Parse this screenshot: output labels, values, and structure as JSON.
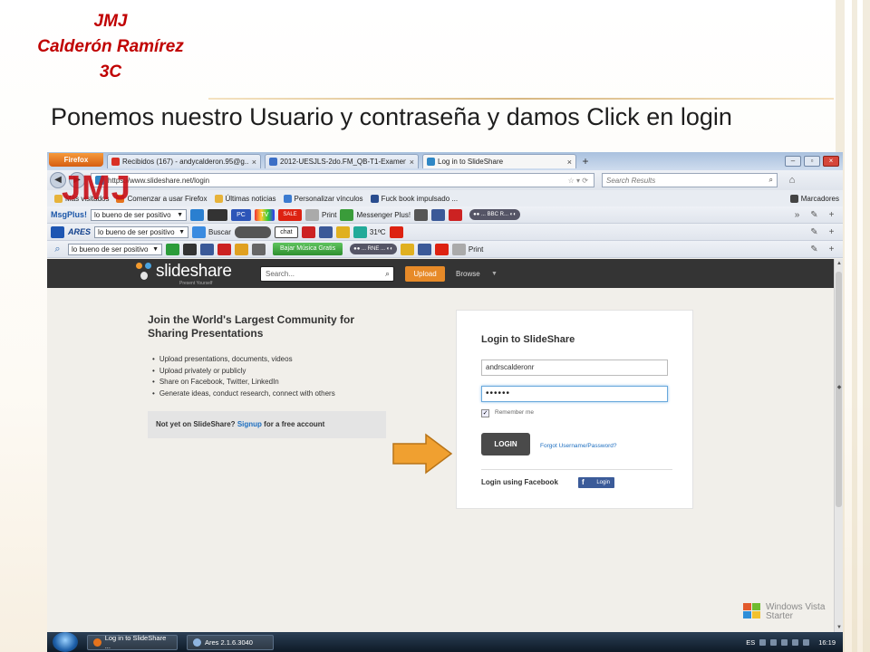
{
  "slide": {
    "author_line1": "JMJ",
    "author_line2": "Calderón Ramírez",
    "author_line3": "3C",
    "caption": "Ponemos nuestro Usuario y contraseña y damos Click en login",
    "overlay_text": "JMJ"
  },
  "browser": {
    "app_button": "Firefox",
    "tabs": [
      {
        "label": "Recibidos (167) - andycalderon.95@g...",
        "icon": "gmail-icon",
        "active": false
      },
      {
        "label": "2012-UESJLS-2do.FM_QB-T1-Examen...",
        "icon": "doc-icon",
        "active": false
      },
      {
        "label": "Log in to SlideShare",
        "icon": "slideshare-icon",
        "active": true
      }
    ],
    "url": "https://www.slideshare.net/login",
    "search_placeholder": "Search Results",
    "bookmarks": [
      "Más visitados",
      "Comenzar a usar Firefox",
      "Últimas noticias",
      "Personalizar vínculos",
      "Fuck book impulsado ..."
    ],
    "bookmarks_menu": "Marcadores",
    "toolbar1": {
      "brand": "MsgPlus!",
      "dropdown": "lo bueno de ser positivo",
      "tv": "TV",
      "sale": "SALE",
      "print": "Print",
      "messenger": "Messenger Plus!"
    },
    "toolbar2": {
      "brand": "ARES",
      "dropdown": "lo bueno de ser positivo",
      "search": "Buscar",
      "chat": "chat",
      "weather": "31ºC",
      "radio": "... BBC R..."
    },
    "toolbar3": {
      "dropdown": "lo bueno de ser positivo",
      "download": "Bajar Música Gratis",
      "print": "Print",
      "radio": "... RNE ..."
    }
  },
  "slideshare": {
    "logo": "slideshare",
    "logo_sub": "Present Yourself",
    "search_placeholder": "Search...",
    "upload_label": "Upload",
    "browse_label": "Browse",
    "join_title": "Join the World's Largest Community for Sharing Presentations",
    "join_items": [
      "Upload presentations, documents, videos",
      "Upload privately or publicly",
      "Share on Facebook, Twitter, LinkedIn",
      "Generate ideas, conduct research, connect with others"
    ],
    "signup_prefix": "Not yet on SlideShare?",
    "signup_link": "Signup",
    "signup_suffix": "for a free account",
    "login_title": "Login to SlideShare",
    "username_value": "andrscalderonr",
    "password_value": "••••••",
    "remember_label": "Remember me",
    "login_button": "LOGIN",
    "forgot_link": "Forgot Username/Password?",
    "facebook_label": "Login using Facebook",
    "facebook_button": "Login"
  },
  "os": {
    "watermark_line1": "Windows Vista",
    "watermark_line2": "Starter",
    "taskbar_items": [
      "Log in to SlideShare ...",
      "Ares 2.1.6.3040"
    ],
    "language": "ES",
    "clock": "16:19"
  },
  "colors": {
    "accent_red": "#c00000",
    "slideshare_orange": "#e78a28",
    "annotation_arrow": "#f0a030"
  }
}
